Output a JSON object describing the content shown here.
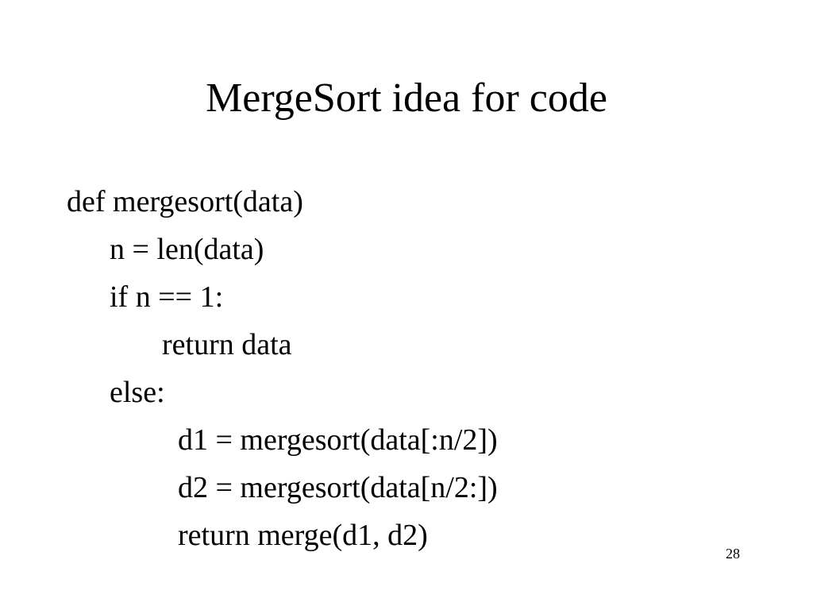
{
  "slide": {
    "title": "MergeSort idea for code",
    "lines": [
      "def mergesort(data)",
      "n = len(data)",
      "if  n == 1:",
      "return data",
      "else:",
      "d1 = mergesort(data[:n/2])",
      "d2 = mergesort(data[n/2:])",
      "return merge(d1, d2)"
    ],
    "page_number": "28"
  }
}
